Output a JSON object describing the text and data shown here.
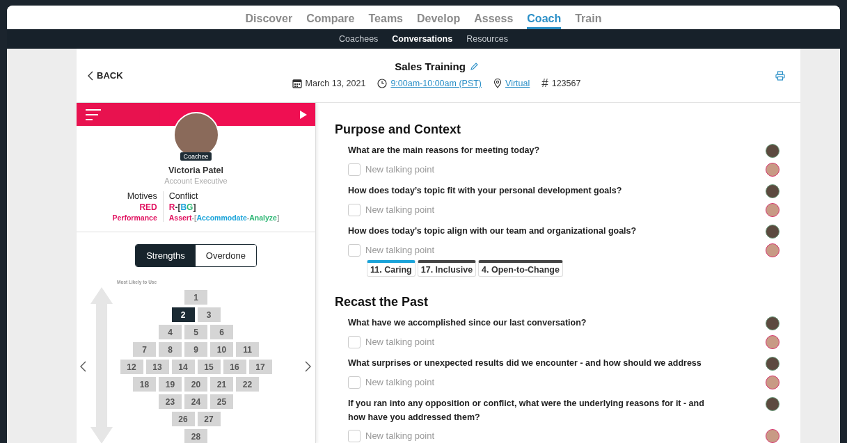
{
  "top_nav": [
    {
      "label": "Discover",
      "selected": false
    },
    {
      "label": "Compare",
      "selected": false
    },
    {
      "label": "Teams",
      "selected": false
    },
    {
      "label": "Develop",
      "selected": false
    },
    {
      "label": "Assess",
      "selected": false
    },
    {
      "label": "Coach",
      "selected": true
    },
    {
      "label": "Train",
      "selected": false
    }
  ],
  "sub_nav": [
    {
      "label": "Coachees",
      "selected": false
    },
    {
      "label": "Conversations",
      "selected": true
    },
    {
      "label": "Resources",
      "selected": false
    }
  ],
  "header": {
    "back": "BACK",
    "title": "Sales Training",
    "date": "March 13, 2021",
    "time": "9:00am-10:00am (PST)",
    "location": "Virtual",
    "hash": "#",
    "number": "123567"
  },
  "coachee": {
    "badge": "Coachee",
    "name": "Victoria Patel",
    "role": "Account Executive",
    "motives": {
      "label": "Motives",
      "value": [
        {
          "text": "RED",
          "color": "#e0115f"
        }
      ],
      "detail": [
        {
          "text": "Performance",
          "color": "#e0115f"
        }
      ]
    },
    "conflict": {
      "label": "Conflict",
      "value": [
        {
          "text": "R",
          "color": "#e0115f"
        },
        {
          "text": "-[",
          "color": "#333333"
        },
        {
          "text": "B",
          "color": "#1aa3d9"
        },
        {
          "text": "G",
          "color": "#2bb673"
        },
        {
          "text": "]",
          "color": "#333333"
        }
      ],
      "detail": [
        {
          "text": "Assert",
          "color": "#e0115f"
        },
        {
          "text": "-[",
          "color": "#aaaaaa"
        },
        {
          "text": "Accommodate",
          "color": "#1aa3d9"
        },
        {
          "text": "-",
          "color": "#aaaaaa"
        },
        {
          "text": "Analyze",
          "color": "#2bb673"
        },
        {
          "text": "]",
          "color": "#aaaaaa"
        }
      ]
    }
  },
  "toggle": [
    {
      "label": "Strengths",
      "selected": true
    },
    {
      "label": "Overdone",
      "selected": false
    }
  ],
  "grid_label": "Most Likely to Use",
  "grid_rows": [
    [
      {
        "label": "1",
        "selected": false
      }
    ],
    [
      {
        "label": "2",
        "selected": true
      },
      {
        "label": "3",
        "selected": false
      }
    ],
    [
      {
        "label": "4",
        "selected": false
      },
      {
        "label": "5",
        "selected": false
      },
      {
        "label": "6",
        "selected": false
      }
    ],
    [
      {
        "label": "7",
        "selected": false
      },
      {
        "label": "8",
        "selected": false
      },
      {
        "label": "9",
        "selected": false
      },
      {
        "label": "10",
        "selected": false
      },
      {
        "label": "11",
        "selected": false
      }
    ],
    [
      {
        "label": "12",
        "selected": false
      },
      {
        "label": "13",
        "selected": false
      },
      {
        "label": "14",
        "selected": false
      },
      {
        "label": "15",
        "selected": false
      },
      {
        "label": "16",
        "selected": false
      },
      {
        "label": "17",
        "selected": false
      }
    ],
    [
      {
        "label": "18",
        "selected": false
      },
      {
        "label": "19",
        "selected": false
      },
      {
        "label": "20",
        "selected": false
      },
      {
        "label": "21",
        "selected": false
      },
      {
        "label": "22",
        "selected": false
      }
    ],
    [
      {
        "label": "23",
        "selected": false
      },
      {
        "label": "24",
        "selected": false
      },
      {
        "label": "25",
        "selected": false
      }
    ],
    [
      {
        "label": "26",
        "selected": false
      },
      {
        "label": "27",
        "selected": false
      }
    ],
    [
      {
        "label": "28",
        "selected": false
      }
    ]
  ],
  "sections": [
    {
      "title": "Purpose and Context",
      "questions": [
        {
          "text": "What are the main reasons for meeting today?",
          "placeholder": "New talking point",
          "checked": false
        },
        {
          "text": "How does today’s topic fit with your personal development goals?",
          "placeholder": "New talking point",
          "checked": false
        },
        {
          "text": "How does today’s topic align with our team and organizational goals?",
          "placeholder": "New talking point",
          "checked": false,
          "tags": [
            {
              "label": "11. Caring",
              "color": "#1aa3d9"
            },
            {
              "label": "17. Inclusive",
              "color": "#444444"
            },
            {
              "label": "4. Open-to-Change",
              "color": "#444444"
            }
          ]
        }
      ]
    },
    {
      "title": "Recast the Past",
      "questions": [
        {
          "text": "What have we accomplished since our last conversation?",
          "placeholder": "New talking point",
          "checked": false
        },
        {
          "text": "What surprises or unexpected results did we encounter - and how should we address",
          "placeholder": "New talking point",
          "checked": false
        },
        {
          "text": "If you ran into any opposition or conflict, what were the underlying reasons for it - and how have you addressed them?",
          "placeholder": "New talking point",
          "checked": false
        }
      ]
    }
  ]
}
